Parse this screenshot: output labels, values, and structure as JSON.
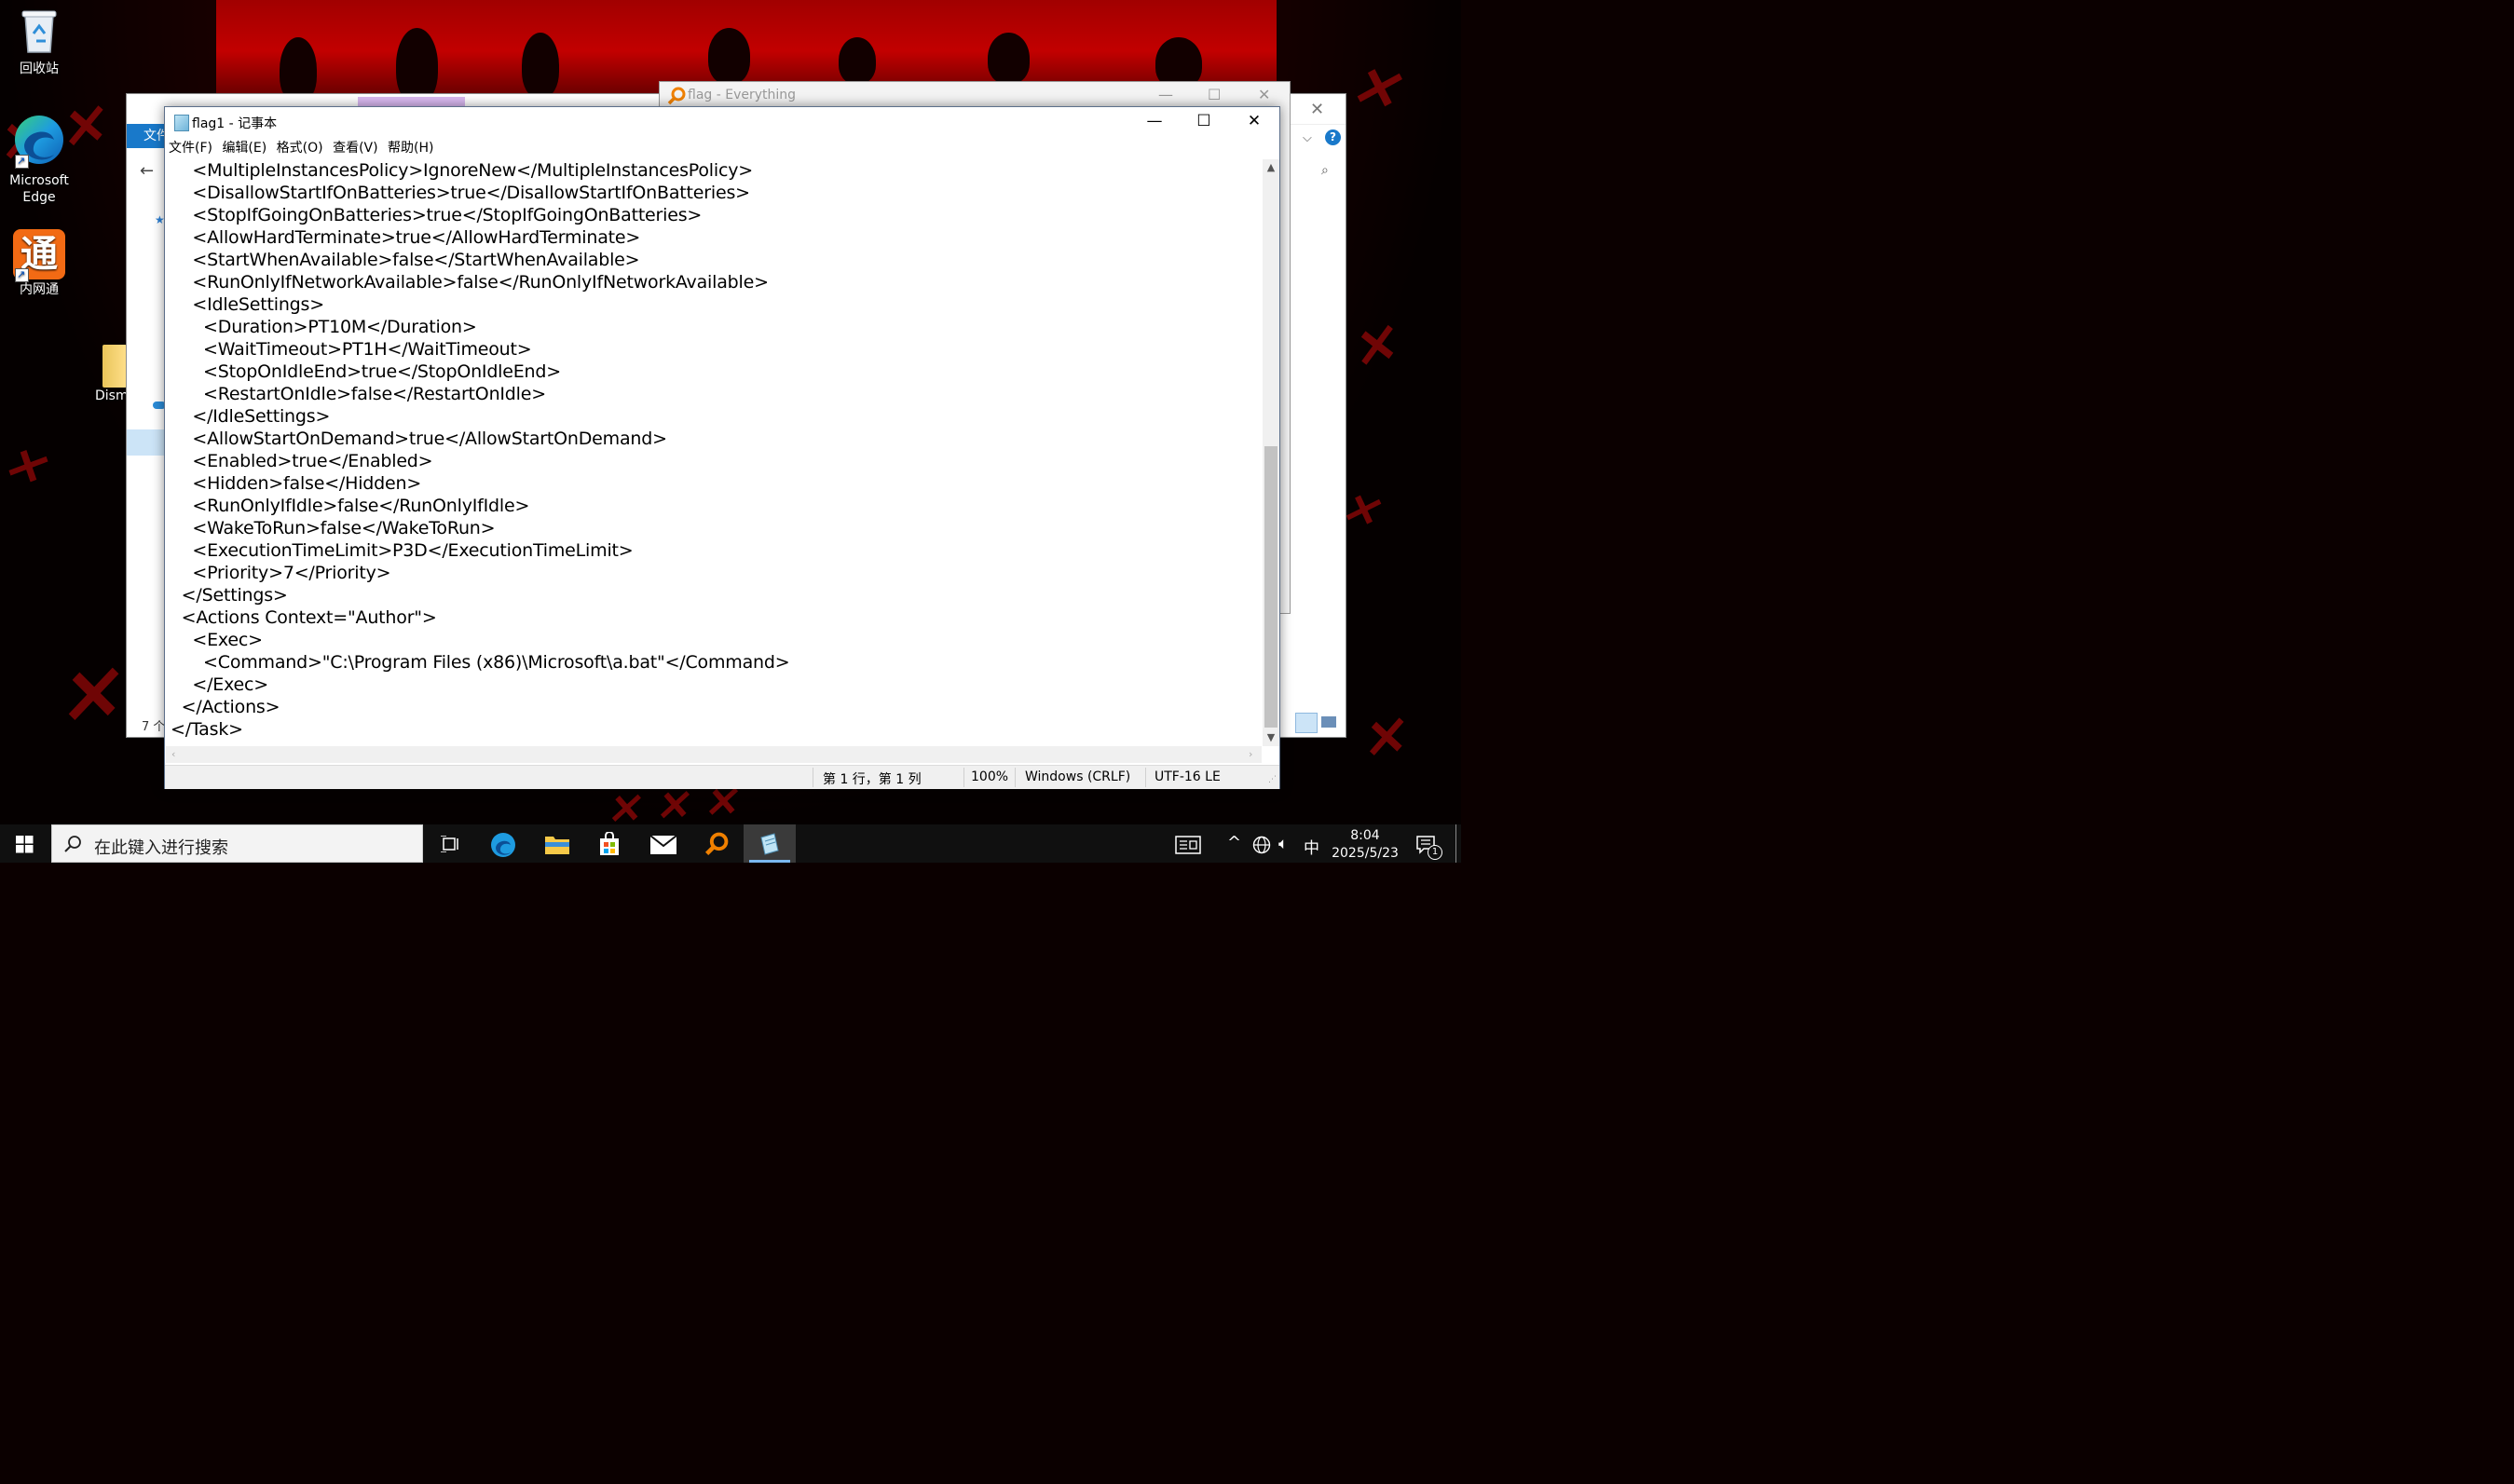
{
  "desktop": {
    "icons": [
      {
        "label": "回收站",
        "icon": "recycle-bin-icon"
      },
      {
        "label": "Microsoft Edge",
        "icon": "edge-icon"
      },
      {
        "label": "内网通",
        "icon": "neiwangtong-icon"
      },
      {
        "label": "Dism",
        "icon": "dism-folder-icon"
      }
    ]
  },
  "explorer": {
    "ribbon_tab": "文件",
    "item_count": "7 个"
  },
  "everything": {
    "title": "flag - Everything"
  },
  "notepad": {
    "title": "flag1 - 记事本",
    "menu": [
      "文件(F)",
      "编辑(E)",
      "格式(O)",
      "查看(V)",
      "帮助(H)"
    ],
    "lines": [
      "    <MultipleInstancesPolicy>IgnoreNew</MultipleInstancesPolicy>",
      "    <DisallowStartIfOnBatteries>true</DisallowStartIfOnBatteries>",
      "    <StopIfGoingOnBatteries>true</StopIfGoingOnBatteries>",
      "    <AllowHardTerminate>true</AllowHardTerminate>",
      "    <StartWhenAvailable>false</StartWhenAvailable>",
      "    <RunOnlyIfNetworkAvailable>false</RunOnlyIfNetworkAvailable>",
      "    <IdleSettings>",
      "      <Duration>PT10M</Duration>",
      "      <WaitTimeout>PT1H</WaitTimeout>",
      "      <StopOnIdleEnd>true</StopOnIdleEnd>",
      "      <RestartOnIdle>false</RestartOnIdle>",
      "    </IdleSettings>",
      "    <AllowStartOnDemand>true</AllowStartOnDemand>",
      "    <Enabled>true</Enabled>",
      "    <Hidden>false</Hidden>",
      "    <RunOnlyIfIdle>false</RunOnlyIfIdle>",
      "    <WakeToRun>false</WakeToRun>",
      "    <ExecutionTimeLimit>P3D</ExecutionTimeLimit>",
      "    <Priority>7</Priority>",
      "  </Settings>",
      "  <Actions Context=\"Author\">",
      "    <Exec>",
      "      <Command>\"C:\\Program Files (x86)\\Microsoft\\a.bat\"</Command>",
      "    </Exec>",
      "  </Actions>",
      "</Task>"
    ],
    "status": {
      "position": "第 1 行，第 1 列",
      "zoom": "100%",
      "line_ending": "Windows (CRLF)",
      "encoding": "UTF-16 LE"
    }
  },
  "taskbar": {
    "search_placeholder": "在此键入进行搜索",
    "ime": "中",
    "time": "8:04",
    "date": "2025/5/23",
    "notification_count": "1"
  }
}
